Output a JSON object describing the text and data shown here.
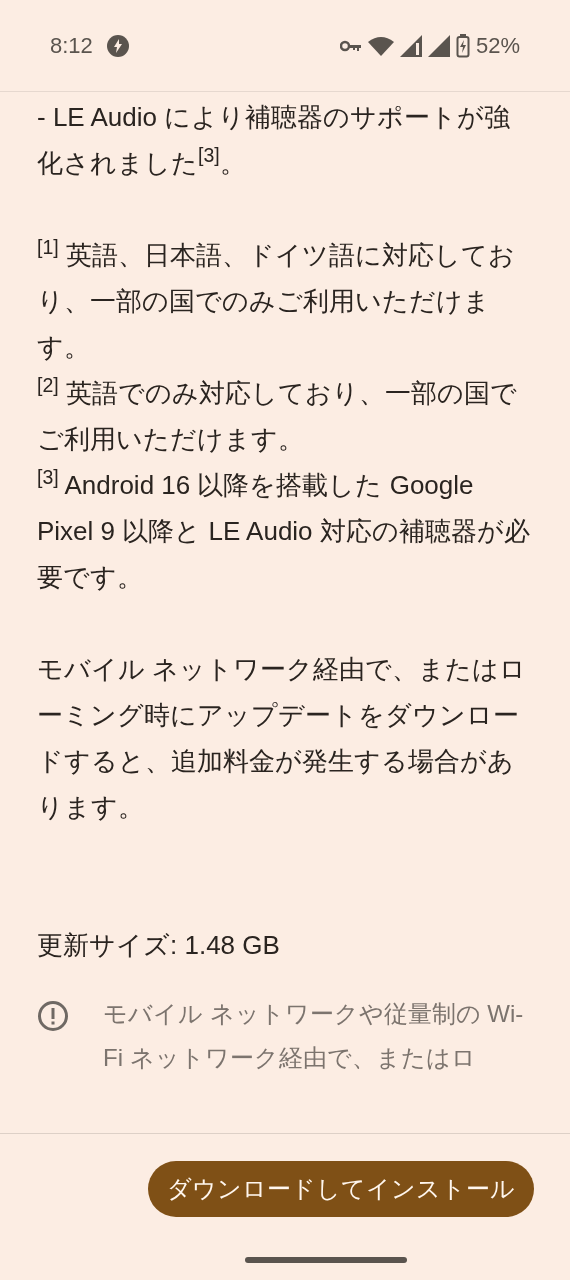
{
  "status_bar": {
    "time": "8:12",
    "battery": "52%"
  },
  "paragraphs": [
    {
      "kind": "body",
      "text": "- LE Audio により補聴器のサポートが強化されました$^{[3]}$。"
    },
    {
      "kind": "gap"
    },
    {
      "kind": "note",
      "text": "$^{[1]}$ 英語、日本語、ドイツ語に対応しており、一部の国でのみご利用いただけます。"
    },
    {
      "kind": "note",
      "text": "$^{[2]}$ 英語でのみ対応しており、一部の国でご利用いただけます。"
    },
    {
      "kind": "note",
      "text": "$^{[3]}$ Android 16 以降を搭載した Google Pixel 9 以降と LE Audio 対応の補聴器が必要です。"
    },
    {
      "kind": "gap"
    },
    {
      "kind": "body",
      "text": "モバイル ネットワーク経由で、またはローミング時にアップデートをダウンロードすると、追加料金が発生する場合があります。"
    },
    {
      "kind": "gap"
    },
    {
      "kind": "gap"
    },
    {
      "kind": "body",
      "text": "更新サイズ: 1.48 GB"
    }
  ],
  "warning": {
    "text": "モバイル ネットワークや従量制の Wi-Fi ネットワーク経由で、またはロ"
  },
  "button": {
    "label": "ダウンロードしてインストール"
  }
}
